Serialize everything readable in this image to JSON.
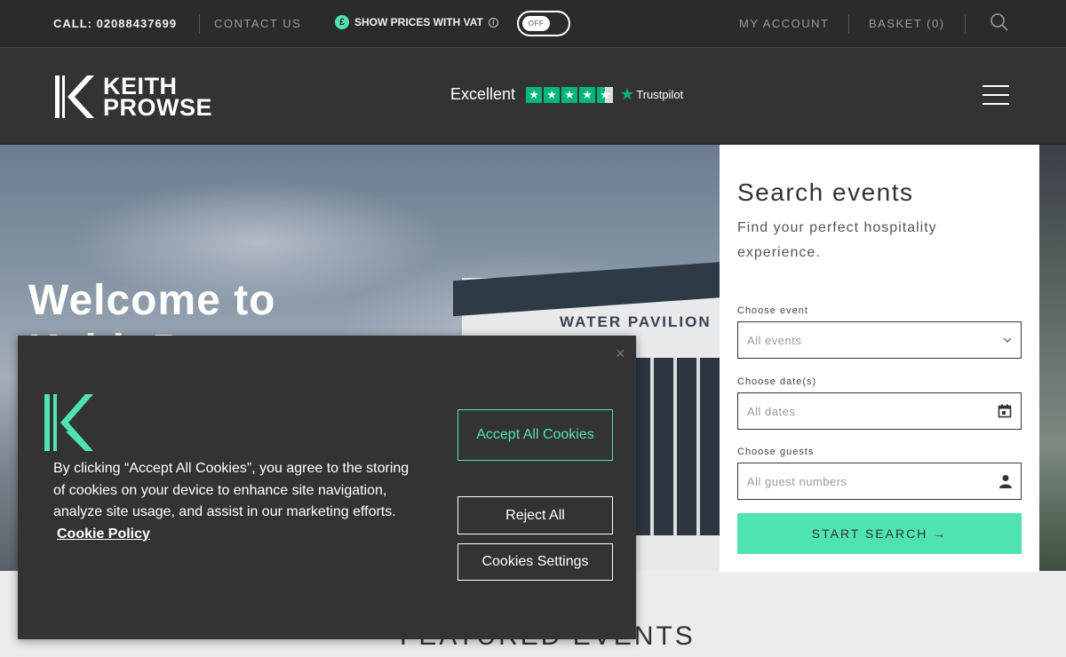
{
  "topbar": {
    "call": "CALL: 02088437699",
    "contact": "CONTACT US",
    "vat_label": "SHOW PRICES WITH VAT",
    "vat_toggle": "OFF",
    "account": "MY ACCOUNT",
    "basket": "BASKET (0)"
  },
  "header": {
    "logo_line1": "KEITH",
    "logo_line2": "PROWSE",
    "trustpilot_rating": "Excellent",
    "trustpilot_brand": "Trustpilot"
  },
  "hero": {
    "title_line1": "Welcome to",
    "title_line2": "Keith Prowse",
    "sign": "WATER PAVILION"
  },
  "search": {
    "title": "Search events",
    "subtitle": "Find your perfect hospitality experience.",
    "event_label": "Choose event",
    "event_placeholder": "All events",
    "date_label": "Choose date(s)",
    "date_placeholder": "All dates",
    "guests_label": "Choose guests",
    "guests_placeholder": "All guest numbers",
    "button": "START SEARCH →"
  },
  "featured": {
    "heading": "FEATURED EVENTS"
  },
  "cookie": {
    "body": "By clicking “Accept All Cookies”, you agree to the storing of cookies on your device to enhance site navigation, analyze site usage, and assist in our marketing efforts.",
    "policy_link": "Cookie Policy",
    "accept": "Accept All Cookies",
    "reject": "Reject All",
    "settings": "Cookies Settings",
    "close": "×"
  },
  "colors": {
    "accent": "#4fe3b2",
    "dark": "#2b2b2b",
    "trustpilot": "#00b67a"
  }
}
